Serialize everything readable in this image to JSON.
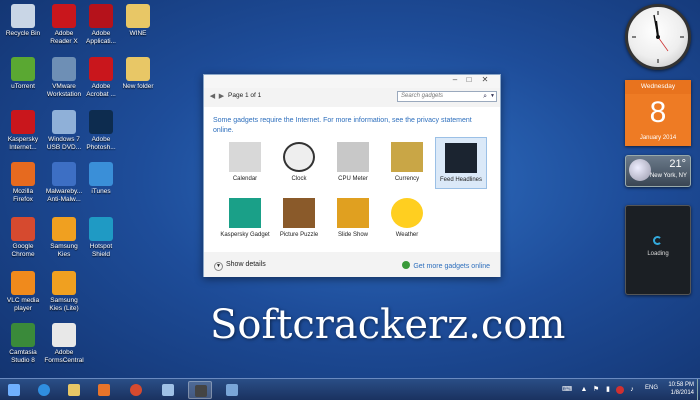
{
  "desktop_icons": [
    {
      "label": "Recycle Bin",
      "icon": "recycle-bin-icon",
      "color": "#c9d6e6"
    },
    {
      "label": "Adobe Reader X",
      "icon": "adobe-reader-icon",
      "color": "#c9161c"
    },
    {
      "label": "Adobe Applicati...",
      "icon": "adobe-app-icon",
      "color": "#b5121b"
    },
    {
      "label": "WINE",
      "icon": "folder-icon",
      "color": "#e8c766"
    },
    {
      "label": "uTorrent",
      "icon": "utorrent-icon",
      "color": "#5aa832"
    },
    {
      "label": "VMware Workstation",
      "icon": "vmware-icon",
      "color": "#6e8fb5"
    },
    {
      "label": "Adobe Acrobat ...",
      "icon": "adobe-acrobat-icon",
      "color": "#c9161c"
    },
    {
      "label": "New folder",
      "icon": "folder-icon",
      "color": "#e8c766"
    },
    {
      "label": "Kaspersky Internet...",
      "icon": "kaspersky-icon",
      "color": "#c9161c"
    },
    {
      "label": "Windows 7 USB DVD...",
      "icon": "usb-dvd-icon",
      "color": "#8fb0d8"
    },
    {
      "label": "Adobe Photosh...",
      "icon": "photoshop-icon",
      "color": "#0d2c4f"
    },
    {
      "label": "Mozilla Firefox",
      "icon": "firefox-icon",
      "color": "#e66a1f"
    },
    {
      "label": "Malwareby... Anti-Malw...",
      "icon": "malwarebytes-icon",
      "color": "#3d6fc4"
    },
    {
      "label": "iTunes",
      "icon": "itunes-icon",
      "color": "#3a8fd8"
    },
    {
      "label": "Google Chrome",
      "icon": "chrome-icon",
      "color": "#d64a2f"
    },
    {
      "label": "Samsung Kies",
      "icon": "samsung-kies-icon",
      "color": "#f0a020"
    },
    {
      "label": "Hotspot Shield",
      "icon": "hotspot-shield-icon",
      "color": "#1f9ac4"
    },
    {
      "label": "VLC media player",
      "icon": "vlc-icon",
      "color": "#f08a1c"
    },
    {
      "label": "Samsung Kies (Lite)",
      "icon": "samsung-kies-lite-icon",
      "color": "#f0a020"
    },
    {
      "label": "Camtasia Studio 8",
      "icon": "camtasia-icon",
      "color": "#3a8a3a"
    },
    {
      "label": "Adobe FormsCentral",
      "icon": "forms-central-icon",
      "color": "#e8e8e8"
    }
  ],
  "gallery": {
    "page_indicator": "Page 1 of 1",
    "search_placeholder": "Search gadgets",
    "info_text": "Some gadgets require the Internet.  For more information, see the privacy statement online.",
    "gadgets": [
      {
        "label": "Calendar",
        "icon": "calendar-icon"
      },
      {
        "label": "Clock",
        "icon": "clock-icon"
      },
      {
        "label": "CPU Meter",
        "icon": "cpu-meter-icon"
      },
      {
        "label": "Currency",
        "icon": "currency-icon"
      },
      {
        "label": "Feed Headlines",
        "icon": "feed-headlines-icon",
        "selected": true
      },
      {
        "label": "Kaspersky Gadget",
        "icon": "kaspersky-gadget-icon"
      },
      {
        "label": "Picture Puzzle",
        "icon": "picture-puzzle-icon"
      },
      {
        "label": "Slide Show",
        "icon": "slide-show-icon"
      },
      {
        "label": "Weather",
        "icon": "weather-icon"
      }
    ],
    "show_details": "Show details",
    "get_more": "Get more gadgets online"
  },
  "watermark": "Softcrackerz.com",
  "sidebar": {
    "calendar": {
      "weekday": "Wednesday",
      "day": "8",
      "month_year": "January 2014"
    },
    "weather": {
      "temp": "21°",
      "city": "New York, NY"
    },
    "feed": {
      "status": "Loading"
    }
  },
  "taskbar": {
    "apps": [
      {
        "name": "start-button",
        "icon": "windows-logo-icon",
        "color": "#6fb0ff"
      },
      {
        "name": "internet-explorer",
        "icon": "ie-icon",
        "color": "#2f8ee0"
      },
      {
        "name": "file-explorer",
        "icon": "folder-icon",
        "color": "#e8c766"
      },
      {
        "name": "media-player",
        "icon": "media-player-icon",
        "color": "#e8742a"
      },
      {
        "name": "chrome",
        "icon": "chrome-icon",
        "color": "#d64a2f"
      },
      {
        "name": "app-6",
        "icon": "window-icon",
        "color": "#9fc1e6"
      },
      {
        "name": "gadgets-app",
        "icon": "gadgets-icon",
        "color": "#444444"
      },
      {
        "name": "app-8",
        "icon": "window-icon",
        "color": "#7aa6d8"
      }
    ],
    "language": "ENG",
    "time": "10:58 PM",
    "date": "1/8/2014"
  }
}
